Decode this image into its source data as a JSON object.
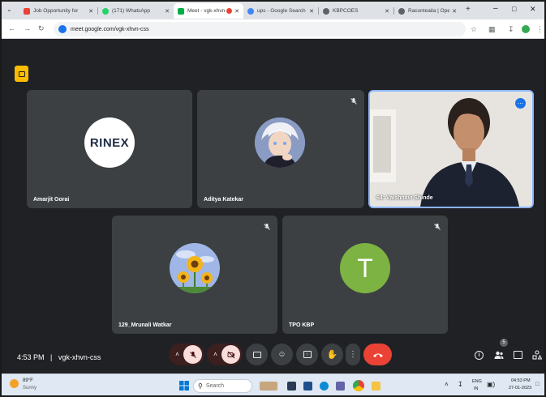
{
  "browser": {
    "tabs": [
      {
        "label": "Job Opportunity for",
        "color": "#ea4335"
      },
      {
        "label": "(171) WhatsApp",
        "color": "#25d366"
      },
      {
        "label": "Meet - vgk-xhvn",
        "color": "#00ac47"
      },
      {
        "label": "ups - Google Search",
        "color": "#4285f4"
      },
      {
        "label": "KBPCOES",
        "color": "#5f6368"
      },
      {
        "label": "Raconteaila | Opening",
        "color": "#5f6368"
      }
    ],
    "url": "meet.google.com/vgk-xhvn-css"
  },
  "meet": {
    "participants": [
      {
        "name": "Amarjit Gorai",
        "logo_text": "RINEX",
        "bg": "#ffffff"
      },
      {
        "name": "Aditya Katekar"
      },
      {
        "name": "64: Vaishnavi Shinde"
      },
      {
        "name": "129_Mrunali Watkar"
      },
      {
        "name": "TPO KBP",
        "initial": "T",
        "bg": "#7cb342"
      }
    ],
    "clock": "4:53 PM",
    "separator": "|",
    "meeting_code": "vgk-xhvn-css",
    "people_count": "5"
  },
  "taskbar": {
    "weather_temp": "89°F",
    "weather_desc": "Sunny",
    "search_placeholder": "Search",
    "lang_top": "ENG",
    "lang_bottom": "IN",
    "time": "04:53 PM",
    "date": "27-01-2023"
  },
  "colors": {
    "meet_bg": "#202124",
    "tile_bg": "#3c4043",
    "mic_off_red": "#f9dedc",
    "end_call": "#ea4335",
    "active_border": "#8ab4f8"
  }
}
